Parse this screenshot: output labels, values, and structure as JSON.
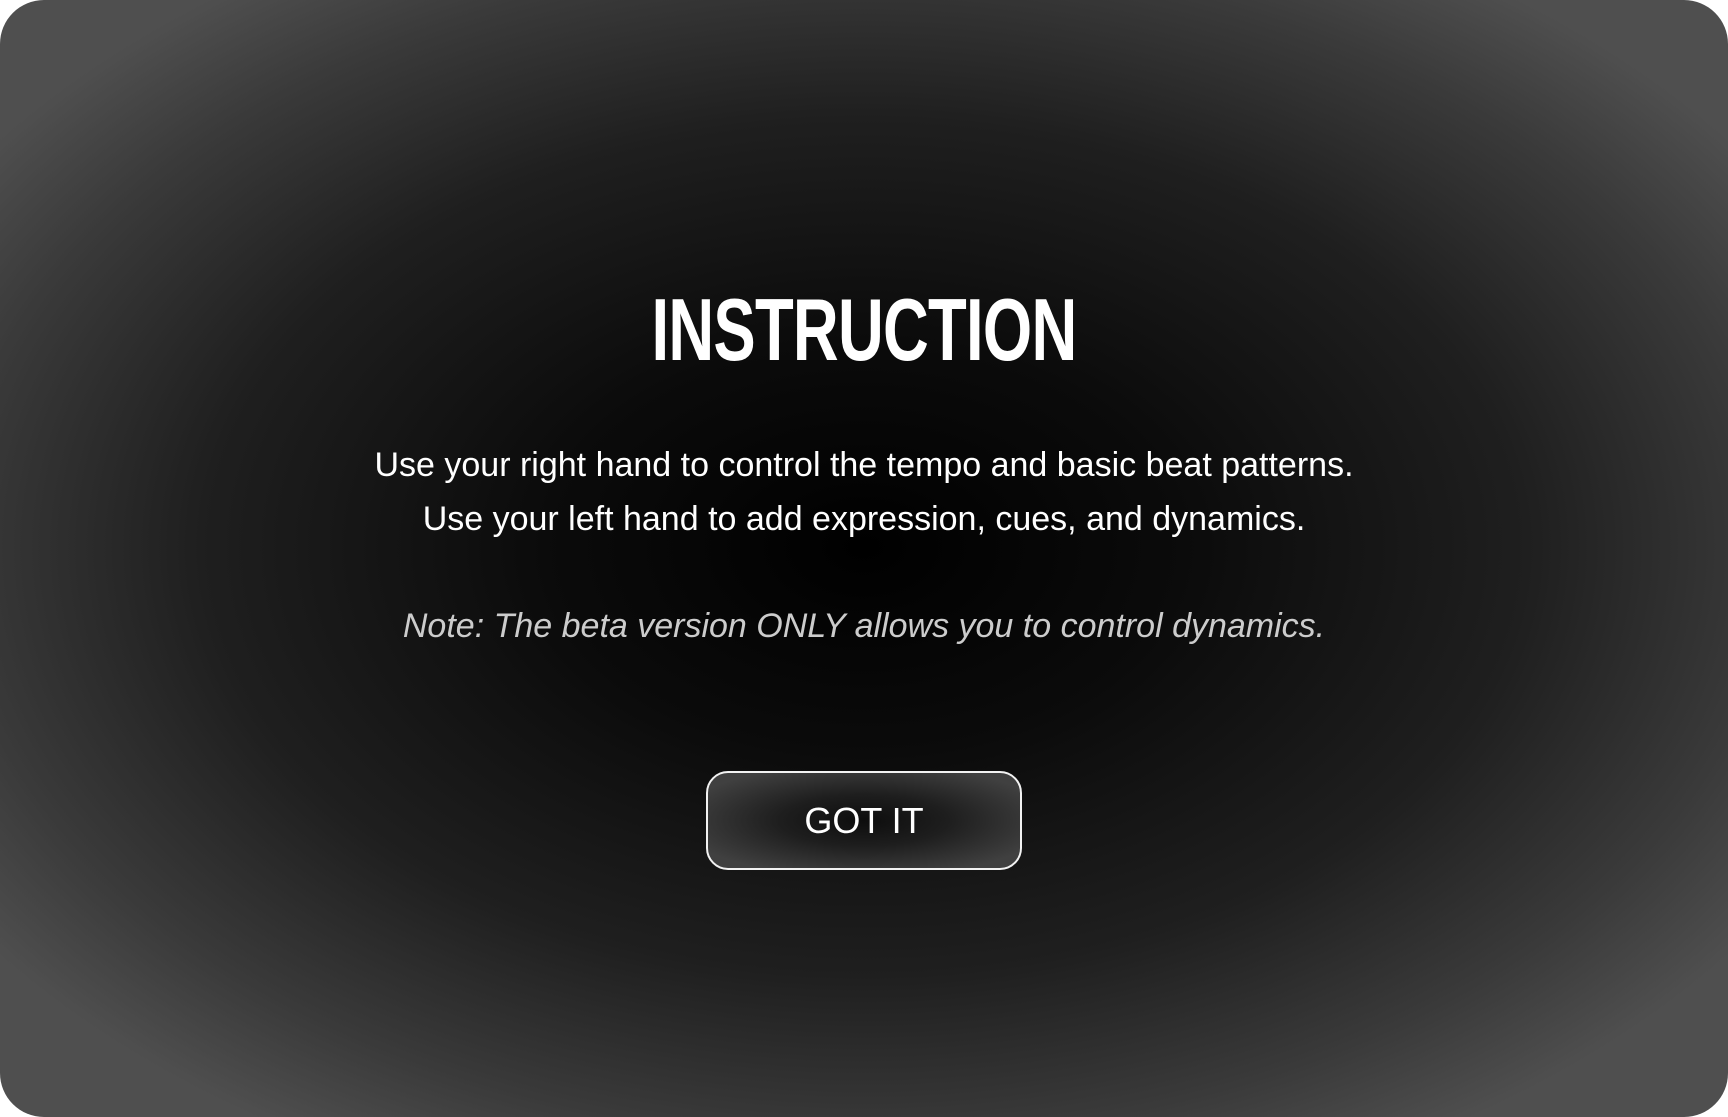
{
  "dialog": {
    "title": "INSTRUCTION",
    "lines": [
      "Use your right hand to control the tempo and basic beat patterns.",
      "Use your left hand to add expression, cues, and dynamics."
    ],
    "note": "Note: The beta version ONLY allows you to control dynamics.",
    "confirm_label": "GOT IT"
  },
  "colors": {
    "background_center": "#000000",
    "background_edge": "#4f4f4f",
    "text": "#ffffff",
    "note_text": "#cccccc",
    "button_border": "#f2f2f2"
  }
}
